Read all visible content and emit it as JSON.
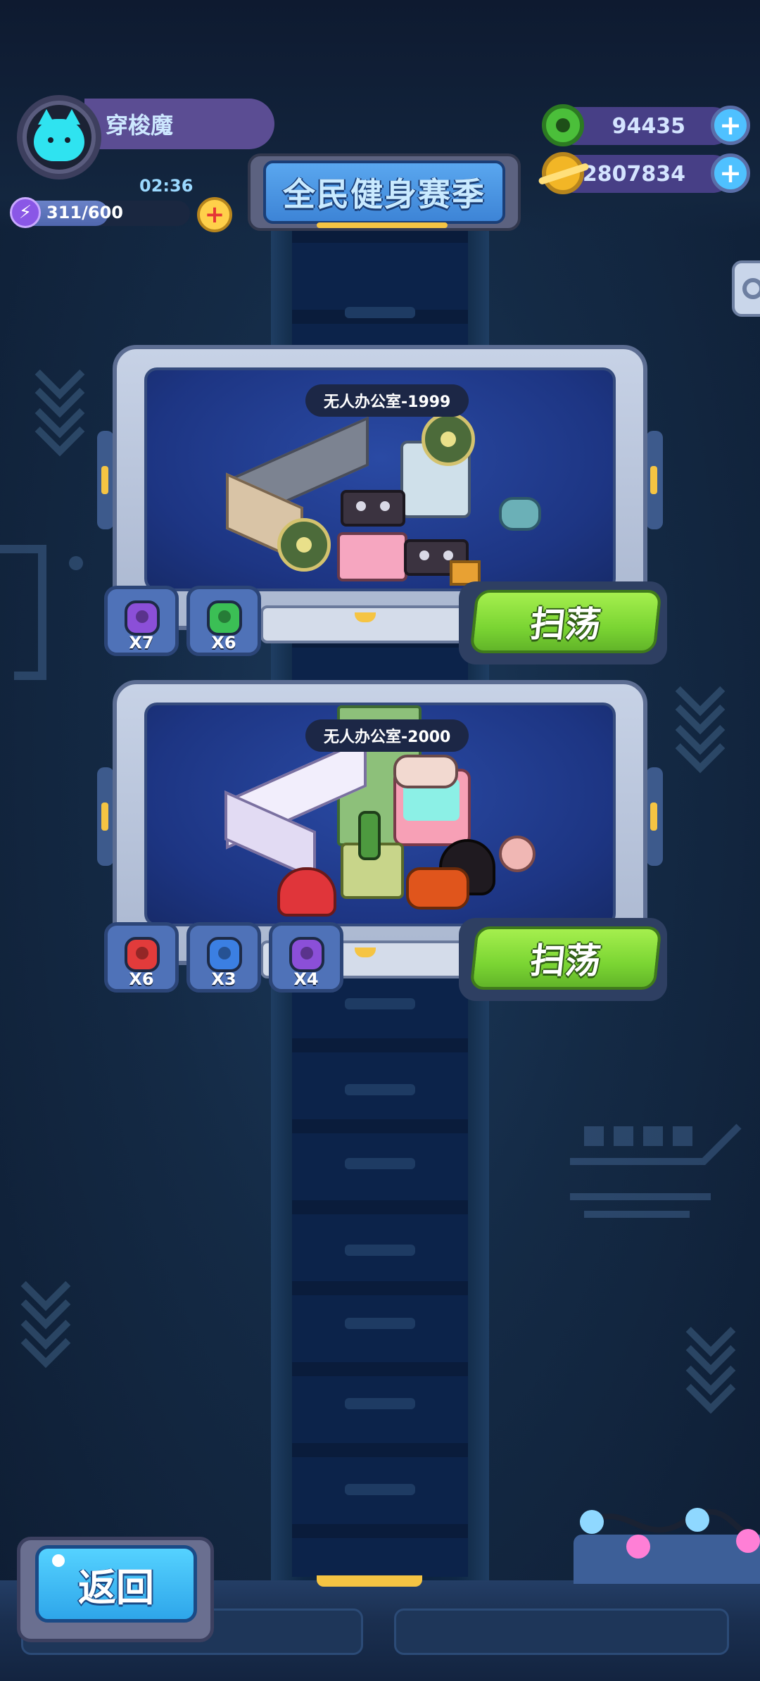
{
  "player": {
    "name": "穿梭魔",
    "timer": "02:36",
    "energy_text": "311/600",
    "energy_fraction": 0.518
  },
  "event_banner": {
    "label": "全民健身赛季"
  },
  "currencies": [
    {
      "id": "donut",
      "value": "94435",
      "icon": "green-donut-icon",
      "color": "#4bbf3a"
    },
    {
      "id": "coin",
      "value": "152807834",
      "icon": "gold-planet-icon",
      "color": "#f2b626"
    }
  ],
  "levels": [
    {
      "title": "无人办公室-1999",
      "rewards": [
        {
          "qty": "X7",
          "icon": "purple-gem-icon",
          "color": "#8b4fd8"
        },
        {
          "qty": "X6",
          "icon": "green-gem-icon",
          "color": "#3bbf55"
        }
      ],
      "sweep_label": "扫荡"
    },
    {
      "title": "无人办公室-2000",
      "rewards": [
        {
          "qty": "X6",
          "icon": "red-gem-icon",
          "color": "#e23b3b"
        },
        {
          "qty": "X3",
          "icon": "blue-gem-icon",
          "color": "#3b7fe2"
        },
        {
          "qty": "X4",
          "icon": "purple-gem-icon",
          "color": "#8b4fd8"
        }
      ],
      "sweep_label": "扫荡"
    }
  ],
  "back_label": "返回",
  "colors": {
    "accent_green": "#7bd533",
    "accent_blue": "#2ea6ea",
    "gold": "#f5c443"
  }
}
